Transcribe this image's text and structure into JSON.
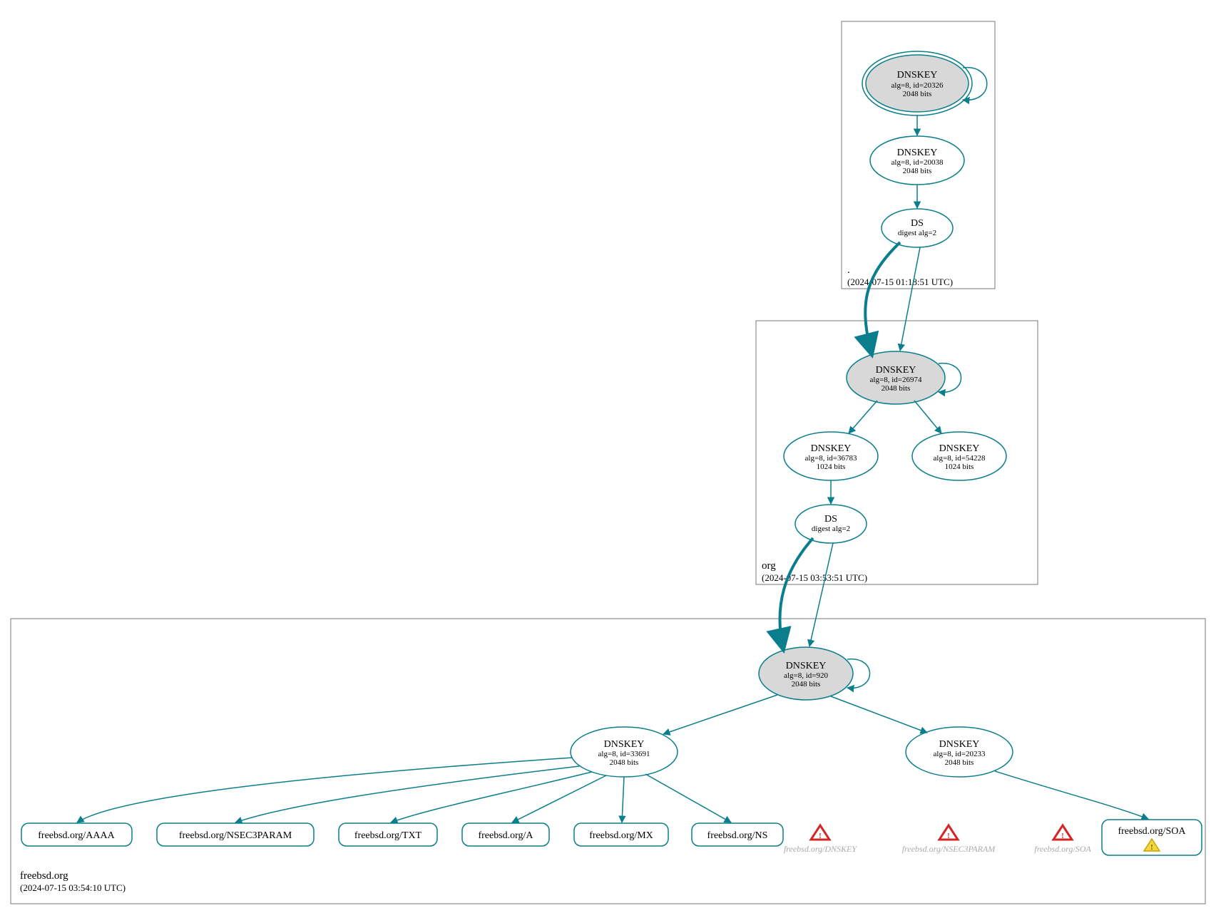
{
  "colors": {
    "stroke": "#0a7e8c",
    "fillKey": "#d8d8d8",
    "warnRed": "#d32626",
    "warnYellow": "#f4d642"
  },
  "zones": {
    "root": {
      "label": ".",
      "timestamp": "(2024-07-15 01:18:51 UTC)",
      "key1": {
        "title": "DNSKEY",
        "line2": "alg=8, id=20326",
        "line3": "2048 bits"
      },
      "key2": {
        "title": "DNSKEY",
        "line2": "alg=8, id=20038",
        "line3": "2048 bits"
      },
      "ds": {
        "title": "DS",
        "line2": "digest alg=2"
      }
    },
    "org": {
      "label": "org",
      "timestamp": "(2024-07-15 03:53:51 UTC)",
      "key1": {
        "title": "DNSKEY",
        "line2": "alg=8, id=26974",
        "line3": "2048 bits"
      },
      "key2": {
        "title": "DNSKEY",
        "line2": "alg=8, id=36783",
        "line3": "1024 bits"
      },
      "key3": {
        "title": "DNSKEY",
        "line2": "alg=8, id=54228",
        "line3": "1024 bits"
      },
      "ds": {
        "title": "DS",
        "line2": "digest alg=2"
      }
    },
    "freebsd": {
      "label": "freebsd.org",
      "timestamp": "(2024-07-15 03:54:10 UTC)",
      "key1": {
        "title": "DNSKEY",
        "line2": "alg=8, id=920",
        "line3": "2048 bits"
      },
      "key2": {
        "title": "DNSKEY",
        "line2": "alg=8, id=33691",
        "line3": "2048 bits"
      },
      "key3": {
        "title": "DNSKEY",
        "line2": "alg=8, id=20233",
        "line3": "2048 bits"
      },
      "leaves": {
        "aaaa": "freebsd.org/AAAA",
        "nsec3": "freebsd.org/NSEC3PARAM",
        "txt": "freebsd.org/TXT",
        "a": "freebsd.org/A",
        "mx": "freebsd.org/MX",
        "ns": "freebsd.org/NS",
        "soa": "freebsd.org/SOA"
      },
      "warnings": {
        "dnskey": "freebsd.org/DNSKEY",
        "nsec3": "freebsd.org/NSEC3PARAM",
        "soa": "freebsd.org/SOA"
      }
    }
  }
}
